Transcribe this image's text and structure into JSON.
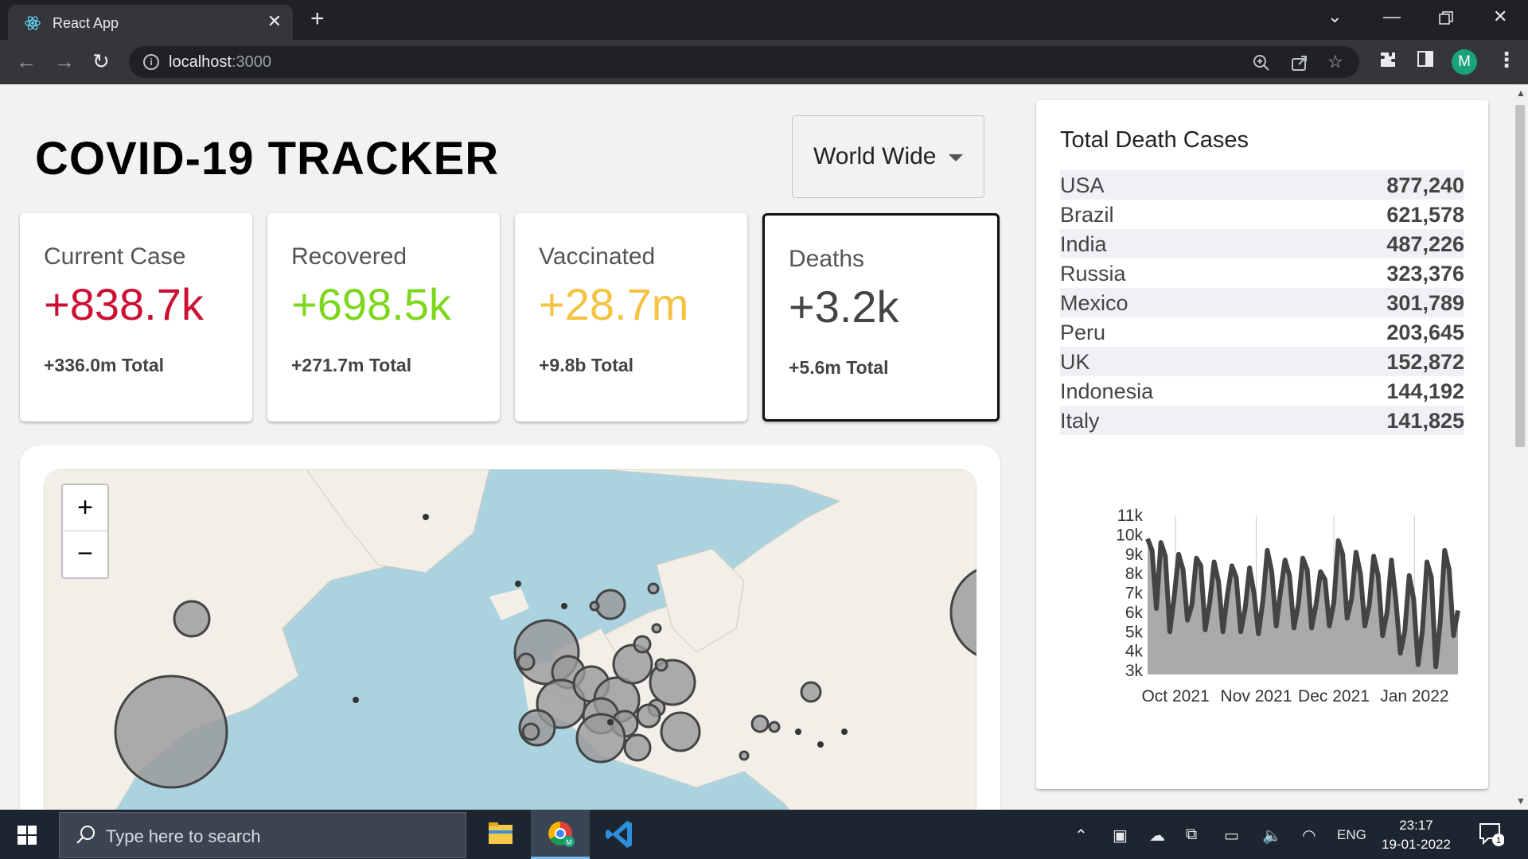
{
  "browser": {
    "tab_title": "React App",
    "tab_close": "✕",
    "new_tab": "+",
    "url_host": "localhost",
    "url_port": ":3000",
    "profile_initial": "M",
    "icons": [
      "back-icon",
      "forward-icon",
      "reload-icon",
      "info-icon",
      "zoom-icon",
      "share-icon",
      "star-icon",
      "extensions-icon",
      "sidepanel-icon",
      "menu-icon"
    ]
  },
  "page": {
    "title": "COVID-19 TRACKER",
    "country_select": {
      "value": "World Wide"
    }
  },
  "cards": [
    {
      "label": "Current Case",
      "value": "+838.7k",
      "total": "+336.0m  Total",
      "color": "#cc1034"
    },
    {
      "label": "Recovered",
      "value": "+698.5k",
      "total": "+271.7m  Total",
      "color": "#7dd71d"
    },
    {
      "label": "Vaccinated",
      "value": "+28.7m",
      "total": "+9.8b  Total",
      "color": "#f5c242"
    },
    {
      "label": "Deaths",
      "value": "+3.2k",
      "total": "+5.6m  Total",
      "color": "#444444"
    }
  ],
  "map": {
    "zoom_in": "+",
    "zoom_out": "−"
  },
  "sidebar": {
    "title": "Total Death Cases",
    "rows": [
      {
        "country": "USA",
        "deaths": "877,240"
      },
      {
        "country": "Brazil",
        "deaths": "621,578"
      },
      {
        "country": "India",
        "deaths": "487,226"
      },
      {
        "country": "Russia",
        "deaths": "323,376"
      },
      {
        "country": "Mexico",
        "deaths": "301,789"
      },
      {
        "country": "Peru",
        "deaths": "203,645"
      },
      {
        "country": "UK",
        "deaths": "152,872"
      },
      {
        "country": "Indonesia",
        "deaths": "144,192"
      },
      {
        "country": "Italy",
        "deaths": "141,825"
      }
    ]
  },
  "chart_data": {
    "type": "area",
    "yticks": [
      "3k",
      "4k",
      "5k",
      "6k",
      "7k",
      "8k",
      "9k",
      "10k",
      "11k"
    ],
    "xticks": [
      "Oct 2021",
      "Nov 2021",
      "Dec 2021",
      "Jan 2022"
    ],
    "ylim": [
      2800,
      11000
    ],
    "y": [
      9800,
      9200,
      6200,
      9600,
      8900,
      5000,
      6800,
      9000,
      8200,
      5600,
      6400,
      8800,
      8400,
      5100,
      6500,
      8600,
      7600,
      5000,
      6900,
      8400,
      7800,
      5000,
      6200,
      8300,
      7000,
      4900,
      6600,
      9200,
      8100,
      5300,
      7100,
      8700,
      7900,
      5200,
      6400,
      8800,
      8200,
      5200,
      6400,
      8100,
      7700,
      5300,
      6500,
      9700,
      9000,
      5700,
      6700,
      9100,
      8000,
      5300,
      6400,
      8900,
      7900,
      4800,
      6000,
      8700,
      6600,
      3900,
      5000,
      7900,
      6700,
      3300,
      5100,
      8600,
      7800,
      3200,
      5500,
      9200,
      8200,
      4800,
      6100
    ],
    "fill": "#aaaaaa",
    "stroke": "#444444"
  },
  "taskbar": {
    "search_placeholder": "Type here to search",
    "language": "ENG",
    "time": "23:17",
    "date": "19-01-2022",
    "notifications": "1"
  }
}
